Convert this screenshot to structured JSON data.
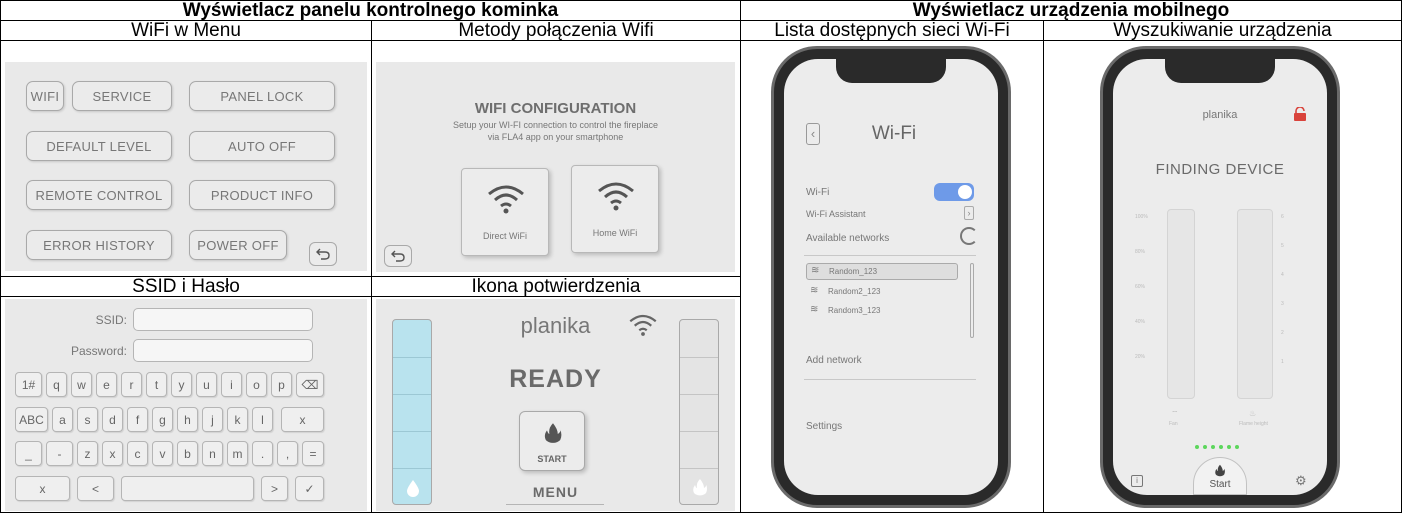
{
  "table": {
    "header_left": "Wyświetlacz panelu kontrolnego kominka",
    "header_right": "Wyświetlacz urządzenia mobilnego",
    "col_wifi_menu": "WiFi w Menu",
    "col_wifi_methods": "Metody połączenia Wifi",
    "col_wifi_list": "Lista dostępnych sieci Wi-Fi",
    "col_device_search": "Wyszukiwanie urządzenia",
    "row2_ssid": "SSID i Hasło",
    "row2_confirm": "Ikona potwierdzenia"
  },
  "menu_panel": {
    "wifi": "WIFI",
    "service": "SERVICE",
    "panel_lock": "PANEL LOCK",
    "default_level": "DEFAULT LEVEL",
    "auto_off": "AUTO OFF",
    "remote_control": "REMOTE CONTROL",
    "product_info": "PRODUCT INFO",
    "error_history": "ERROR HISTORY",
    "power_off": "POWER OFF",
    "back_icon": "back-arrow-icon"
  },
  "wifi_config": {
    "title": "WIFI CONFIGURATION",
    "desc_line1": "Setup your WI-FI connection to control the fireplace",
    "desc_line2": "via FLA4 app on your smartphone",
    "direct": "Direct WiFi",
    "home": "Home WiFi"
  },
  "ssid_panel": {
    "ssid_label": "SSID:",
    "password_label": "Password:",
    "row1": [
      "1#",
      "q",
      "w",
      "e",
      "r",
      "t",
      "y",
      "u",
      "i",
      "o",
      "p",
      "⌫"
    ],
    "row2": [
      "ABC",
      "a",
      "s",
      "d",
      "f",
      "g",
      "h",
      "j",
      "k",
      "l",
      "x"
    ],
    "row3": [
      "_",
      "-",
      "z",
      "x",
      "c",
      "v",
      "b",
      "n",
      "m",
      ".",
      ",",
      "="
    ],
    "row4": [
      "x",
      "<",
      "",
      ">",
      "✓"
    ]
  },
  "ready_panel": {
    "brand": "planika",
    "status": "READY",
    "start": "START",
    "menu": "MENU"
  },
  "phone_wifi": {
    "title": "Wi-Fi",
    "wifi_label": "Wi-Fi",
    "assistant": "Wi-Fi Assistant",
    "available": "Available networks",
    "networks": [
      "Random_123",
      "Random2_123",
      "Random3_123"
    ],
    "add_network": "Add network",
    "settings": "Settings"
  },
  "phone_search": {
    "brand": "planika",
    "status": "FINDING DEVICE",
    "left_ticks": [
      "100%",
      "80%",
      "60%",
      "40%",
      "20%"
    ],
    "right_ticks": [
      "6",
      "5",
      "4",
      "3",
      "2",
      "1"
    ],
    "left_caption": "Fan",
    "right_caption": "Flame height",
    "start": "Start"
  },
  "colors": {
    "panel_bg": "#e9e9e9",
    "water_blue": "#b9e3ee",
    "toggle_blue": "#6e9ae8",
    "lock_red": "#d9433b",
    "dot_green": "#5cd65c"
  }
}
